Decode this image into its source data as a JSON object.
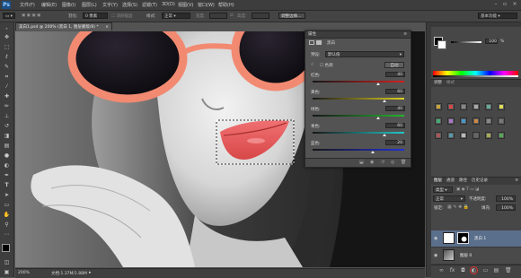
{
  "app": {
    "logo": "Ps"
  },
  "menu": [
    "文件(F)",
    "编辑(E)",
    "图像(I)",
    "图层(L)",
    "文字(Y)",
    "选择(S)",
    "滤镜(T)",
    "3D(D)",
    "视图(V)",
    "窗口(W)",
    "帮助(H)"
  ],
  "options": {
    "feather_label": "羽化:",
    "feather_value": "0 像素",
    "antialias_label": "消除锯齿",
    "style_label": "样式:",
    "style_value": "正常",
    "width_label": "宽度:",
    "height_label": "高度:",
    "refine_edge": "调整边缘...",
    "workspace": "基本功能"
  },
  "document": {
    "tab_title": "美白1.psd @ 200% (黑白 1, 图层蒙版/8) *",
    "close": "×",
    "zoom": "200%",
    "doc_size": "文档:1.37M/1.88M"
  },
  "properties": {
    "tab_label": "属性",
    "panel_title": "黑白",
    "preset_label": "预设:",
    "preset_value": "默认值",
    "tint_label": "色调",
    "auto_button": "自动",
    "sliders": [
      {
        "label": "红色:",
        "value": "40",
        "pos": 0.72,
        "colors": [
          "#161616",
          "#d42020"
        ]
      },
      {
        "label": "黄色:",
        "value": "60",
        "pos": 0.78,
        "colors": [
          "#161616",
          "#e0d020"
        ]
      },
      {
        "label": "绿色:",
        "value": "40",
        "pos": 0.72,
        "colors": [
          "#161616",
          "#24b52c"
        ]
      },
      {
        "label": "青色:",
        "value": "60",
        "pos": 0.78,
        "colors": [
          "#161616",
          "#22c8c8"
        ]
      },
      {
        "label": "蓝色:",
        "value": "20",
        "pos": 0.66,
        "colors": [
          "#161616",
          "#2030d4"
        ]
      }
    ]
  },
  "color_panel": {
    "opacity_value": "100",
    "unit": "%"
  },
  "adjustments": {
    "title": "调整",
    "tab2": "样式"
  },
  "layers_panel": {
    "tabs": [
      "图层",
      "通道",
      "路径",
      "历史记录"
    ],
    "kind_label": "类型",
    "blend_mode": "正常",
    "opacity_label": "不透明度:",
    "opacity_value": "100%",
    "lock_label": "锁定:",
    "fill_label": "填充:",
    "fill_value": "100%",
    "layers": [
      {
        "name": "黑白 1",
        "selected": true
      },
      {
        "name": "图层 0",
        "selected": false
      }
    ]
  },
  "colors": {
    "accent": "#e03030",
    "selected_layer": "#5a6f8c"
  }
}
